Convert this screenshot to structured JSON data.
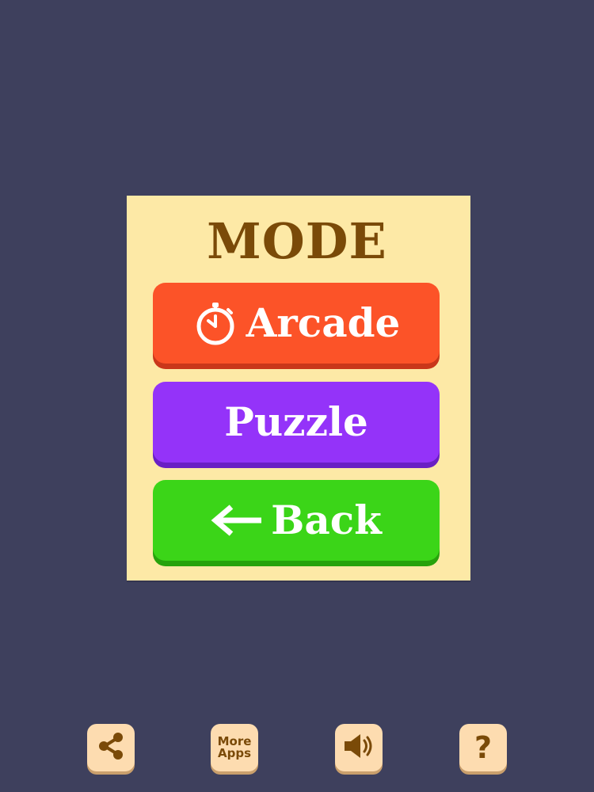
{
  "panel": {
    "title": "MODE"
  },
  "buttons": {
    "arcade_label": "Arcade",
    "puzzle_label": "Puzzle",
    "back_label": "Back"
  },
  "bottom_bar": {
    "more_apps_line1": "More",
    "more_apps_line2": "Apps",
    "help_label": "?"
  },
  "colors": {
    "background": "#3e405d",
    "panel": "#fde9a6",
    "title": "#7a4a08",
    "arcade": "#fc5328",
    "puzzle": "#9433f9",
    "back": "#3bd518",
    "bottom_button": "#fddcb0"
  },
  "icons": {
    "arcade": "stopwatch-icon",
    "back": "arrow-left-icon",
    "share": "share-icon",
    "sound": "speaker-icon",
    "help": "question-mark-icon"
  }
}
